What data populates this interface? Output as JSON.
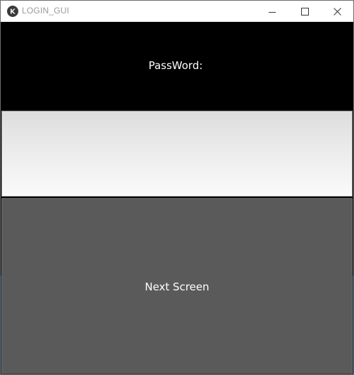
{
  "window": {
    "title": "LOGIN_GUI",
    "icon": "kivy-logo-icon",
    "controls": {
      "minimize": "minimize-icon",
      "maximize": "maximize-icon",
      "close": "close-icon"
    }
  },
  "form": {
    "password_label": "PassWord:",
    "password_value": "",
    "next_button_label": "Next Screen"
  },
  "colors": {
    "label_background": "#000000",
    "label_text": "#ffffff",
    "button_background": "#5a5a5a",
    "button_text": "#ffffff",
    "input_gradient_top": "#dddddd",
    "input_gradient_bottom": "#fafafa"
  }
}
